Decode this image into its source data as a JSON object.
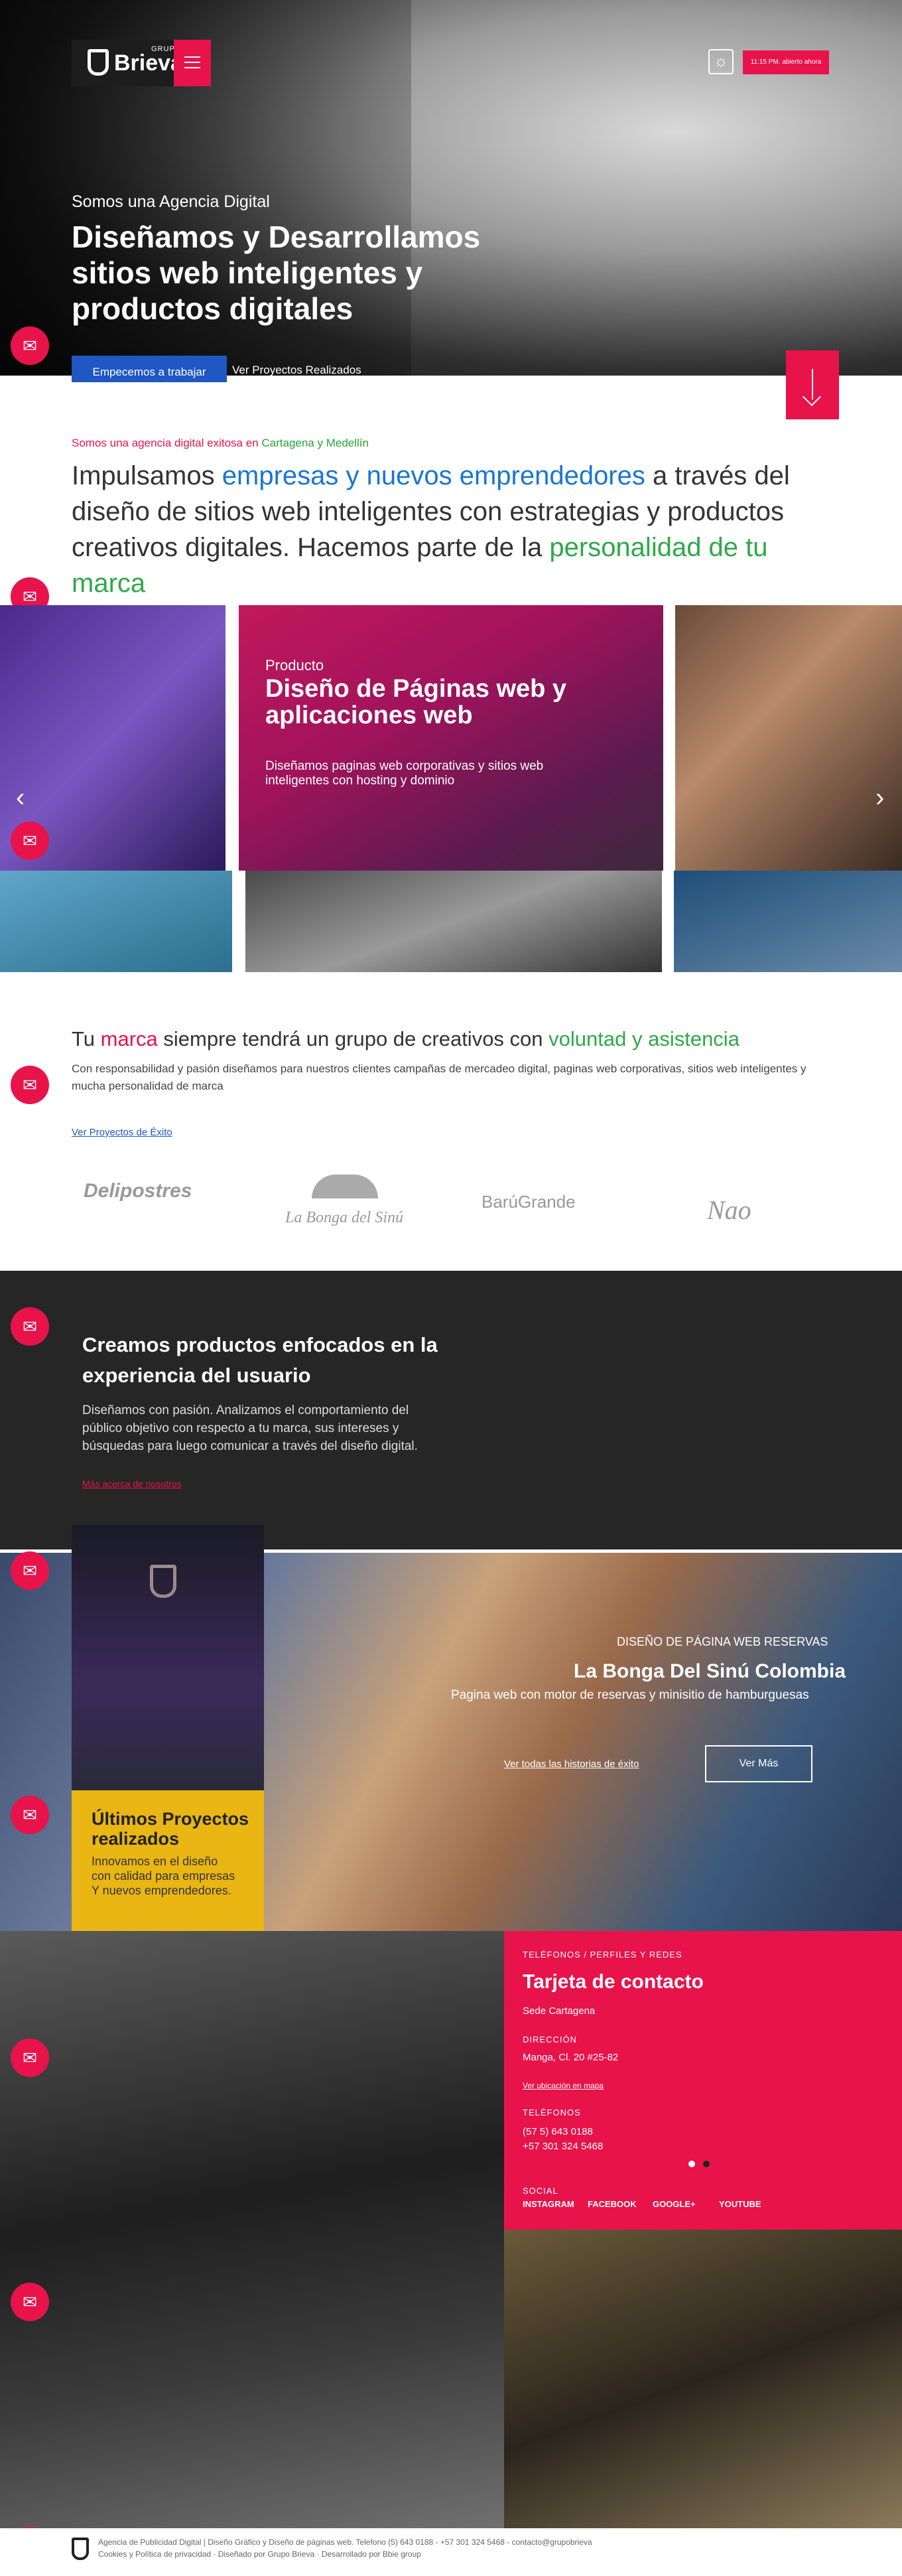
{
  "colors": {
    "accent": "#e8134b",
    "blue": "#1f57c3",
    "green": "#2ea84a",
    "yellow": "#e9b613",
    "dark": "#262626"
  },
  "hero": {
    "logo_grupo": "GRUPO",
    "logo_word": "Brieva",
    "time_badge": "11:15 PM. abierto ahora",
    "kicker": "Somos una Agencia Digital",
    "title": "Diseñamos y Desarrollamos sitios web inteligentes y productos digitales",
    "cta_primary": "Empecemos a trabajar",
    "cta_secondary": "Ver Proyectos Realizados"
  },
  "intro": {
    "kicker": "Somos una agencia digital exitosa en",
    "kicker_cities": "Cartagena y Medellín",
    "text_a": "Impulsamos",
    "text_b": "empresas y nuevos emprendedores",
    "text_c": "a través del diseño de sitios web inteligentes con estrategias y productos creativos digitales. Hacemos parte de la",
    "text_d": "personalidad de tu marca"
  },
  "slider": {
    "kicker": "Producto",
    "title": "Diseño de Páginas web y aplicaciones web",
    "desc": "Diseñamos paginas web corporativas y sitios web inteligentes con hosting y dominio",
    "prev": "‹",
    "next": "›"
  },
  "brand": {
    "title_a": "Tu",
    "title_b": "marca",
    "title_c": "siempre tendrá un grupo de creativos con",
    "title_d": "voluntad y asistencia",
    "desc": "Con responsabilidad y pasión diseñamos para nuestros clientes campañas de mercadeo digital, paginas web corporativas, sitios web inteligentes y mucha personalidad de marca",
    "link": "Ver Proyectos de Éxito",
    "clients": [
      "Delipostres",
      "La Bonga del Sinú",
      "BarúGrande",
      "Nao"
    ]
  },
  "dark": {
    "title": "Creamos productos enfocados en la experiencia del usuario",
    "desc": "Diseñamos con pasión. Analizamos el comportamiento del público objetivo con respecto a tu marca, sus intereses y búsquedas para luego comunicar a través del diseño digital.",
    "link": "Más acerca de nosotros"
  },
  "projects": {
    "card_title": "Últimos Proyectos realizados",
    "card_desc": "Innovamos en el diseño con calidad para empresas Y nuevos emprendedores.",
    "kicker": "DISEÑO DE PÁGINA WEB RESERVAS",
    "title": "La Bonga Del Sinú Colombia",
    "desc": "Pagina web con motor de reservas y minisitio de hamburguesas",
    "link": "Ver todas las historias de éxito",
    "button": "Ver Más"
  },
  "contact": {
    "kicker": "TELÉFONOS / PERFILES Y REDES",
    "title": "Tarjeta de contacto",
    "sede": "Sede Cartagena",
    "dir_label": "DIRECCIÓN",
    "dir_value": "Manga, Cl. 20 #25-82",
    "map_link": "Ver ubicación en mapa",
    "tel_label": "TELÉFONOS",
    "tel_1": "(57 5) 643 0188",
    "tel_2": "+57 301 324 5468",
    "social_label": "SOCIAL",
    "social": [
      "INSTAGRAM",
      "FACEBOOK",
      "GOOGLE+",
      "YOUTUBE"
    ]
  },
  "footer": {
    "line1": "Agencia de Publicidad Digital | Diseño Gráfico y Diseño de páginas web. Telefono (5) 643 0188 - +57 301 324 5468 - contacto@grupobrieva",
    "line2": "Cookies y Política de privacidad · Diseñado por Grupo Brieva · Desarrollado por Bbie group"
  }
}
